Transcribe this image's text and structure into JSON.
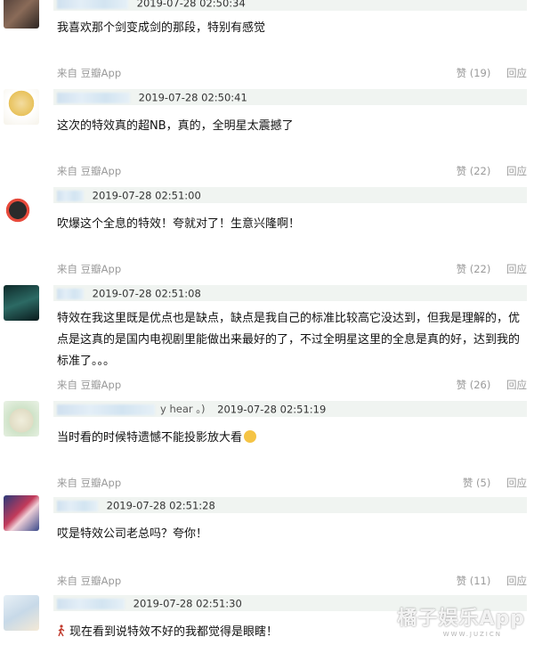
{
  "comments": [
    {
      "timestamp": "2019-07-28 02:50:34",
      "text": "我喜欢那个剑变成剑的那段，特别有感觉",
      "source": "来自 豆瓣App",
      "likes": "赞 (19)",
      "reply": "回应"
    },
    {
      "timestamp": "2019-07-28 02:50:41",
      "text": "这次的特效真的超NB，真的，全明星太震撼了",
      "source": "来自 豆瓣App",
      "likes": "赞 (22)",
      "reply": "回应"
    },
    {
      "timestamp": "2019-07-28 02:51:00",
      "text": "吹爆这个全息的特效！夸就对了！生意兴隆啊！",
      "source": "来自 豆瓣App",
      "likes": "赞 (22)",
      "reply": "回应"
    },
    {
      "timestamp": "2019-07-28 02:51:08",
      "text": "特效在我这里既是优点也是缺点，缺点是我自己的标准比较高它没达到，但我是理解的，优点是这真的是国内电视剧里能做出来最好的了，不过全明星这里的全息是真的好，达到我的标准了。。。",
      "source": "来自 豆瓣App",
      "likes": "赞 (26)",
      "reply": "回应"
    },
    {
      "username_partial": "y hear 。)",
      "timestamp": "2019-07-28 02:51:19",
      "text": "当时看的时候特遗憾不能投影放大看",
      "source": "来自 豆瓣App",
      "likes": "赞 (5)",
      "reply": "回应"
    },
    {
      "timestamp": "2019-07-28 02:51:28",
      "text": "哎是特效公司老总吗？夸你！",
      "source": "来自 豆瓣App",
      "likes": "赞 (11)",
      "reply": "回应"
    },
    {
      "timestamp": "2019-07-28 02:51:30",
      "text": "现在看到说特效不好的我都觉得是眼瞎！"
    }
  ],
  "watermark": {
    "title": "橘子娱乐App",
    "sub": "WWW.JUZICN"
  }
}
